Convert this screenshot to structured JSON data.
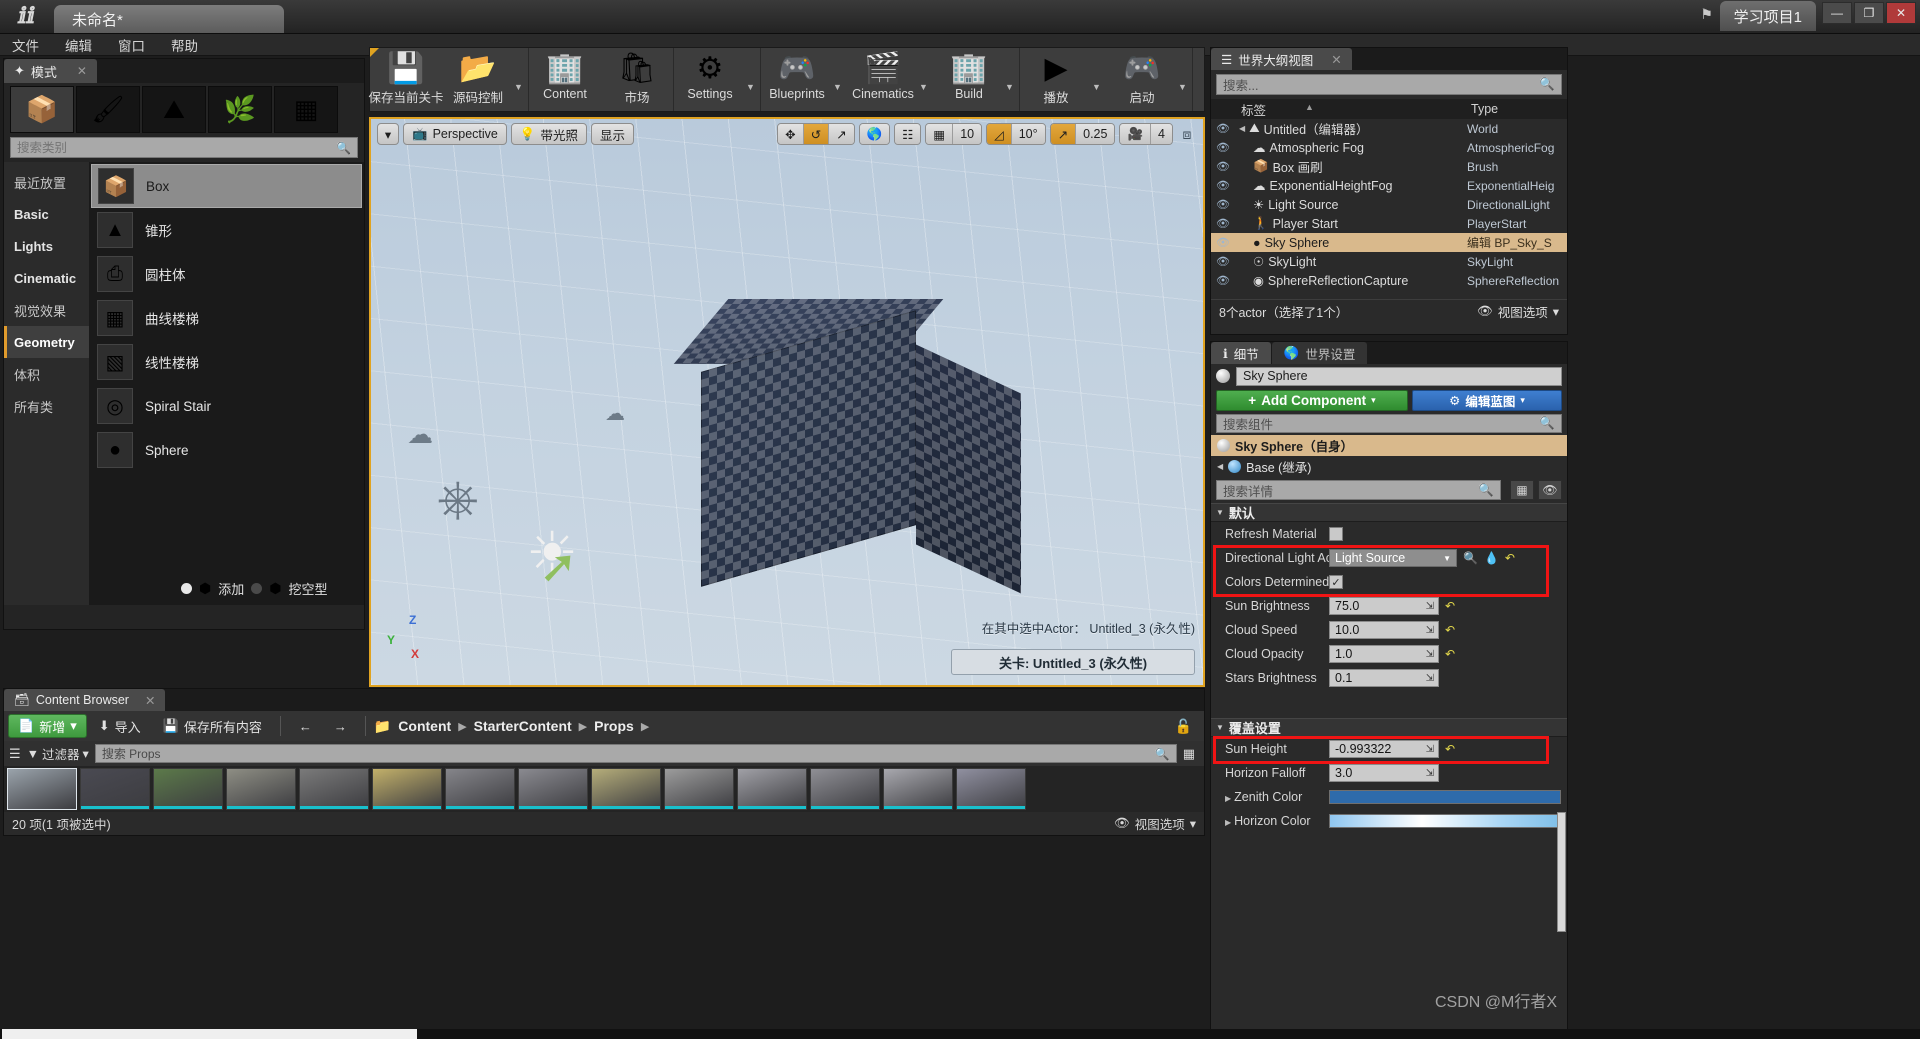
{
  "titlebar": {
    "logo": "ue-logo",
    "doc_tab": "未命名*",
    "project_tab": "学习项目1",
    "flag_icon": "flag-icon",
    "minimize": "—",
    "maximize": "❐",
    "close": "✕"
  },
  "menubar": {
    "items": [
      "文件",
      "编辑",
      "窗口",
      "帮助"
    ]
  },
  "modes": {
    "tab_label": "模式",
    "tab_close": "✕",
    "mode_icons": [
      "placement-mode-icon",
      "paint-mode-icon",
      "landscape-mode-icon",
      "foliage-mode-icon",
      "geometry-mode-icon"
    ],
    "search_placeholder": "搜索类别",
    "categories": [
      {
        "label": "最近放置"
      },
      {
        "label": "Basic"
      },
      {
        "label": "Lights"
      },
      {
        "label": "Cinematic"
      },
      {
        "label": "视觉效果"
      },
      {
        "label": "Geometry"
      },
      {
        "label": "体积"
      },
      {
        "label": "所有类"
      }
    ],
    "active_category": "Geometry",
    "assets": [
      {
        "name": "Box",
        "icon": "box-icon",
        "selected": true
      },
      {
        "name": "锥形",
        "icon": "cone-icon",
        "selected": false
      },
      {
        "name": "圆柱体",
        "icon": "cylinder-icon",
        "selected": false
      },
      {
        "name": "曲线楼梯",
        "icon": "curved-stair-icon",
        "selected": false
      },
      {
        "name": "线性楼梯",
        "icon": "linear-stair-icon",
        "selected": false
      },
      {
        "name": "Spiral Stair",
        "icon": "spiral-stair-icon",
        "selected": false
      },
      {
        "name": "Sphere",
        "icon": "sphere-icon",
        "selected": false
      }
    ],
    "brush_add": "添加",
    "brush_subtract": "挖空型"
  },
  "toolbar": {
    "groups": [
      {
        "items": [
          {
            "label": "保存当前关卡",
            "icon": "save-icon",
            "arrow": false
          },
          {
            "label": "源码控制",
            "icon": "source-control-icon",
            "arrow": true
          }
        ]
      },
      {
        "items": [
          {
            "label": "Content",
            "icon": "content-icon",
            "arrow": false
          },
          {
            "label": "市场",
            "icon": "marketplace-icon",
            "arrow": false
          }
        ]
      },
      {
        "items": [
          {
            "label": "Settings",
            "icon": "settings-gear-icon",
            "arrow": true
          }
        ]
      },
      {
        "items": [
          {
            "label": "Blueprints",
            "icon": "blueprints-icon",
            "arrow": true
          },
          {
            "label": "Cinematics",
            "icon": "cinematics-icon",
            "arrow": true
          },
          {
            "label": "Build",
            "icon": "build-icon",
            "arrow": true
          }
        ]
      },
      {
        "items": [
          {
            "label": "播放",
            "icon": "play-icon",
            "arrow": true
          },
          {
            "label": "启动",
            "icon": "launch-icon",
            "arrow": true
          }
        ]
      }
    ]
  },
  "viewport": {
    "menu_arrow": "▾",
    "perspective": "Perspective",
    "lit": "带光照",
    "show": "显示",
    "translate_icon": "translate-gizmo-icon",
    "rotate_icon": "rotate-gizmo-icon",
    "scale_icon": "scale-gizmo-icon",
    "world_icon": "world-space-icon",
    "surface_snap_icon": "surface-snap-icon",
    "grid_snap_icon": "grid-snap-icon",
    "grid_value": "10",
    "angle_snap_icon": "angle-snap-icon",
    "angle_value": "10°",
    "scale_snap_icon": "scale-snap-icon",
    "scale_value": "0.25",
    "camera_icon": "camera-speed-icon",
    "camera_value": "4",
    "maximize_icon": "maximize-viewport-icon",
    "selection_info": "在其中选中Actor： Untitled_3 (永久性)",
    "level_label": "关卡: Untitled_3 (永久性)",
    "axis_x": "X",
    "axis_y": "Y",
    "axis_z": "Z"
  },
  "content_browser": {
    "tab_label": "Content Browser",
    "tab_close": "✕",
    "add_new": "新增",
    "add_new_arrow": "▾",
    "import": "导入",
    "save_all": "保存所有内容",
    "back_icon": "back-arrow-icon",
    "forward_icon": "forward-arrow-icon",
    "folder_icon": "folder-icon",
    "breadcrumb": [
      "Content",
      "StarterContent",
      "Props"
    ],
    "breadcrumb_sep": "▶",
    "lock_icon": "lock-icon",
    "view_options_icon": "list-view-icon",
    "filter_label": "过滤器",
    "filter_arrow": "▾",
    "search_placeholder": "搜索 Props",
    "status": "20 项(1 项被选中)",
    "view_options": "视图选项",
    "view_options_arrow": "▾",
    "asset_count": 14
  },
  "outliner": {
    "tab_label": "世界大纲视图",
    "tab_close": "✕",
    "search_placeholder": "搜索...",
    "col_label": "标签",
    "col_type": "Type",
    "rows": [
      {
        "name": "Untitled（编辑器）",
        "type": "World",
        "icon": "world-icon",
        "indent": 0,
        "expandable": true,
        "selected": false
      },
      {
        "name": "Atmospheric Fog",
        "type": "AtmosphericFog",
        "icon": "fog-icon",
        "indent": 1,
        "expandable": false,
        "selected": false
      },
      {
        "name": "Box 画刷",
        "type": "Brush",
        "icon": "brush-icon",
        "indent": 1,
        "expandable": false,
        "selected": false
      },
      {
        "name": "ExponentialHeightFog",
        "type": "ExponentialHeig",
        "icon": "height-fog-icon",
        "indent": 1,
        "expandable": false,
        "selected": false
      },
      {
        "name": "Light Source",
        "type": "DirectionalLight",
        "icon": "directional-light-icon",
        "indent": 1,
        "expandable": false,
        "selected": false
      },
      {
        "name": "Player Start",
        "type": "PlayerStart",
        "icon": "player-start-icon",
        "indent": 1,
        "expandable": false,
        "selected": false
      },
      {
        "name": "Sky Sphere",
        "type": "编辑 BP_Sky_S",
        "icon": "sky-sphere-icon",
        "indent": 1,
        "expandable": false,
        "selected": true
      },
      {
        "name": "SkyLight",
        "type": "SkyLight",
        "icon": "skylight-icon",
        "indent": 1,
        "expandable": false,
        "selected": false
      },
      {
        "name": "SphereReflectionCapture",
        "type": "SphereReflection",
        "icon": "sphere-reflection-icon",
        "indent": 1,
        "expandable": false,
        "selected": false
      }
    ],
    "footer_count": "8个actor（选择了1个）",
    "footer_view_options": "视图选项",
    "footer_arrow": "▾",
    "eye_icon": "eye-icon"
  },
  "details": {
    "tab_details": "细节",
    "tab_world": "世界设置",
    "actor_name": "Sky Sphere",
    "add_component": "Add Component",
    "add_component_plus": "+",
    "add_component_arrow": "▾",
    "edit_blueprint": "编辑蓝图",
    "edit_blueprint_arrow": "▾",
    "component_search_placeholder": "搜索组件",
    "components": [
      {
        "label": "Sky Sphere（自身）",
        "icon": "sky-sphere-icon",
        "selected": true
      },
      {
        "label": "Base (继承)",
        "icon": "static-mesh-icon",
        "selected": false
      }
    ],
    "details_search_placeholder": "搜索详情",
    "grid_view_icon": "grid-view-icon",
    "eye_view_icon": "eye-view-icon",
    "section_default": "默认",
    "section_override": "覆盖设置",
    "properties": [
      {
        "name": "Refresh Material",
        "type": "checkbox",
        "value": false,
        "reset": false,
        "highlight": false
      },
      {
        "name": "Directional Light Ac",
        "type": "combo",
        "value": "Light Source",
        "reset": true,
        "pick": true,
        "search": true,
        "highlight": true
      },
      {
        "name": "Colors Determined",
        "type": "checkbox",
        "value": true,
        "reset": false,
        "highlight": true
      },
      {
        "name": "Sun Brightness",
        "type": "number",
        "value": "75.0",
        "reset": true,
        "highlight": false
      },
      {
        "name": "Cloud Speed",
        "type": "number",
        "value": "10.0",
        "reset": true,
        "highlight": false
      },
      {
        "name": "Cloud Opacity",
        "type": "number",
        "value": "1.0",
        "reset": true,
        "highlight": false
      },
      {
        "name": "Stars Brightness",
        "type": "number",
        "value": "0.1",
        "reset": false,
        "highlight": false
      }
    ],
    "override_properties": [
      {
        "name": "Sun Height",
        "type": "number",
        "value": "-0.993322",
        "reset": true,
        "highlight": true
      },
      {
        "name": "Horizon Falloff",
        "type": "number",
        "value": "3.0",
        "reset": false,
        "highlight": false
      },
      {
        "name": "Zenith Color",
        "type": "color",
        "value": "#2e6bab",
        "expandable": true,
        "highlight": false
      },
      {
        "name": "Horizon Color",
        "type": "gradient",
        "value": "#cfe8fb",
        "expandable": true,
        "highlight": false
      }
    ]
  },
  "watermark": "CSDN @M行者X",
  "colors": {
    "accent_orange": "#e0a321",
    "highlight_red": "#f01414",
    "selection_tan": "#d9b98c",
    "green_button": "#3e9a3e",
    "blue_button": "#2a62ad"
  }
}
